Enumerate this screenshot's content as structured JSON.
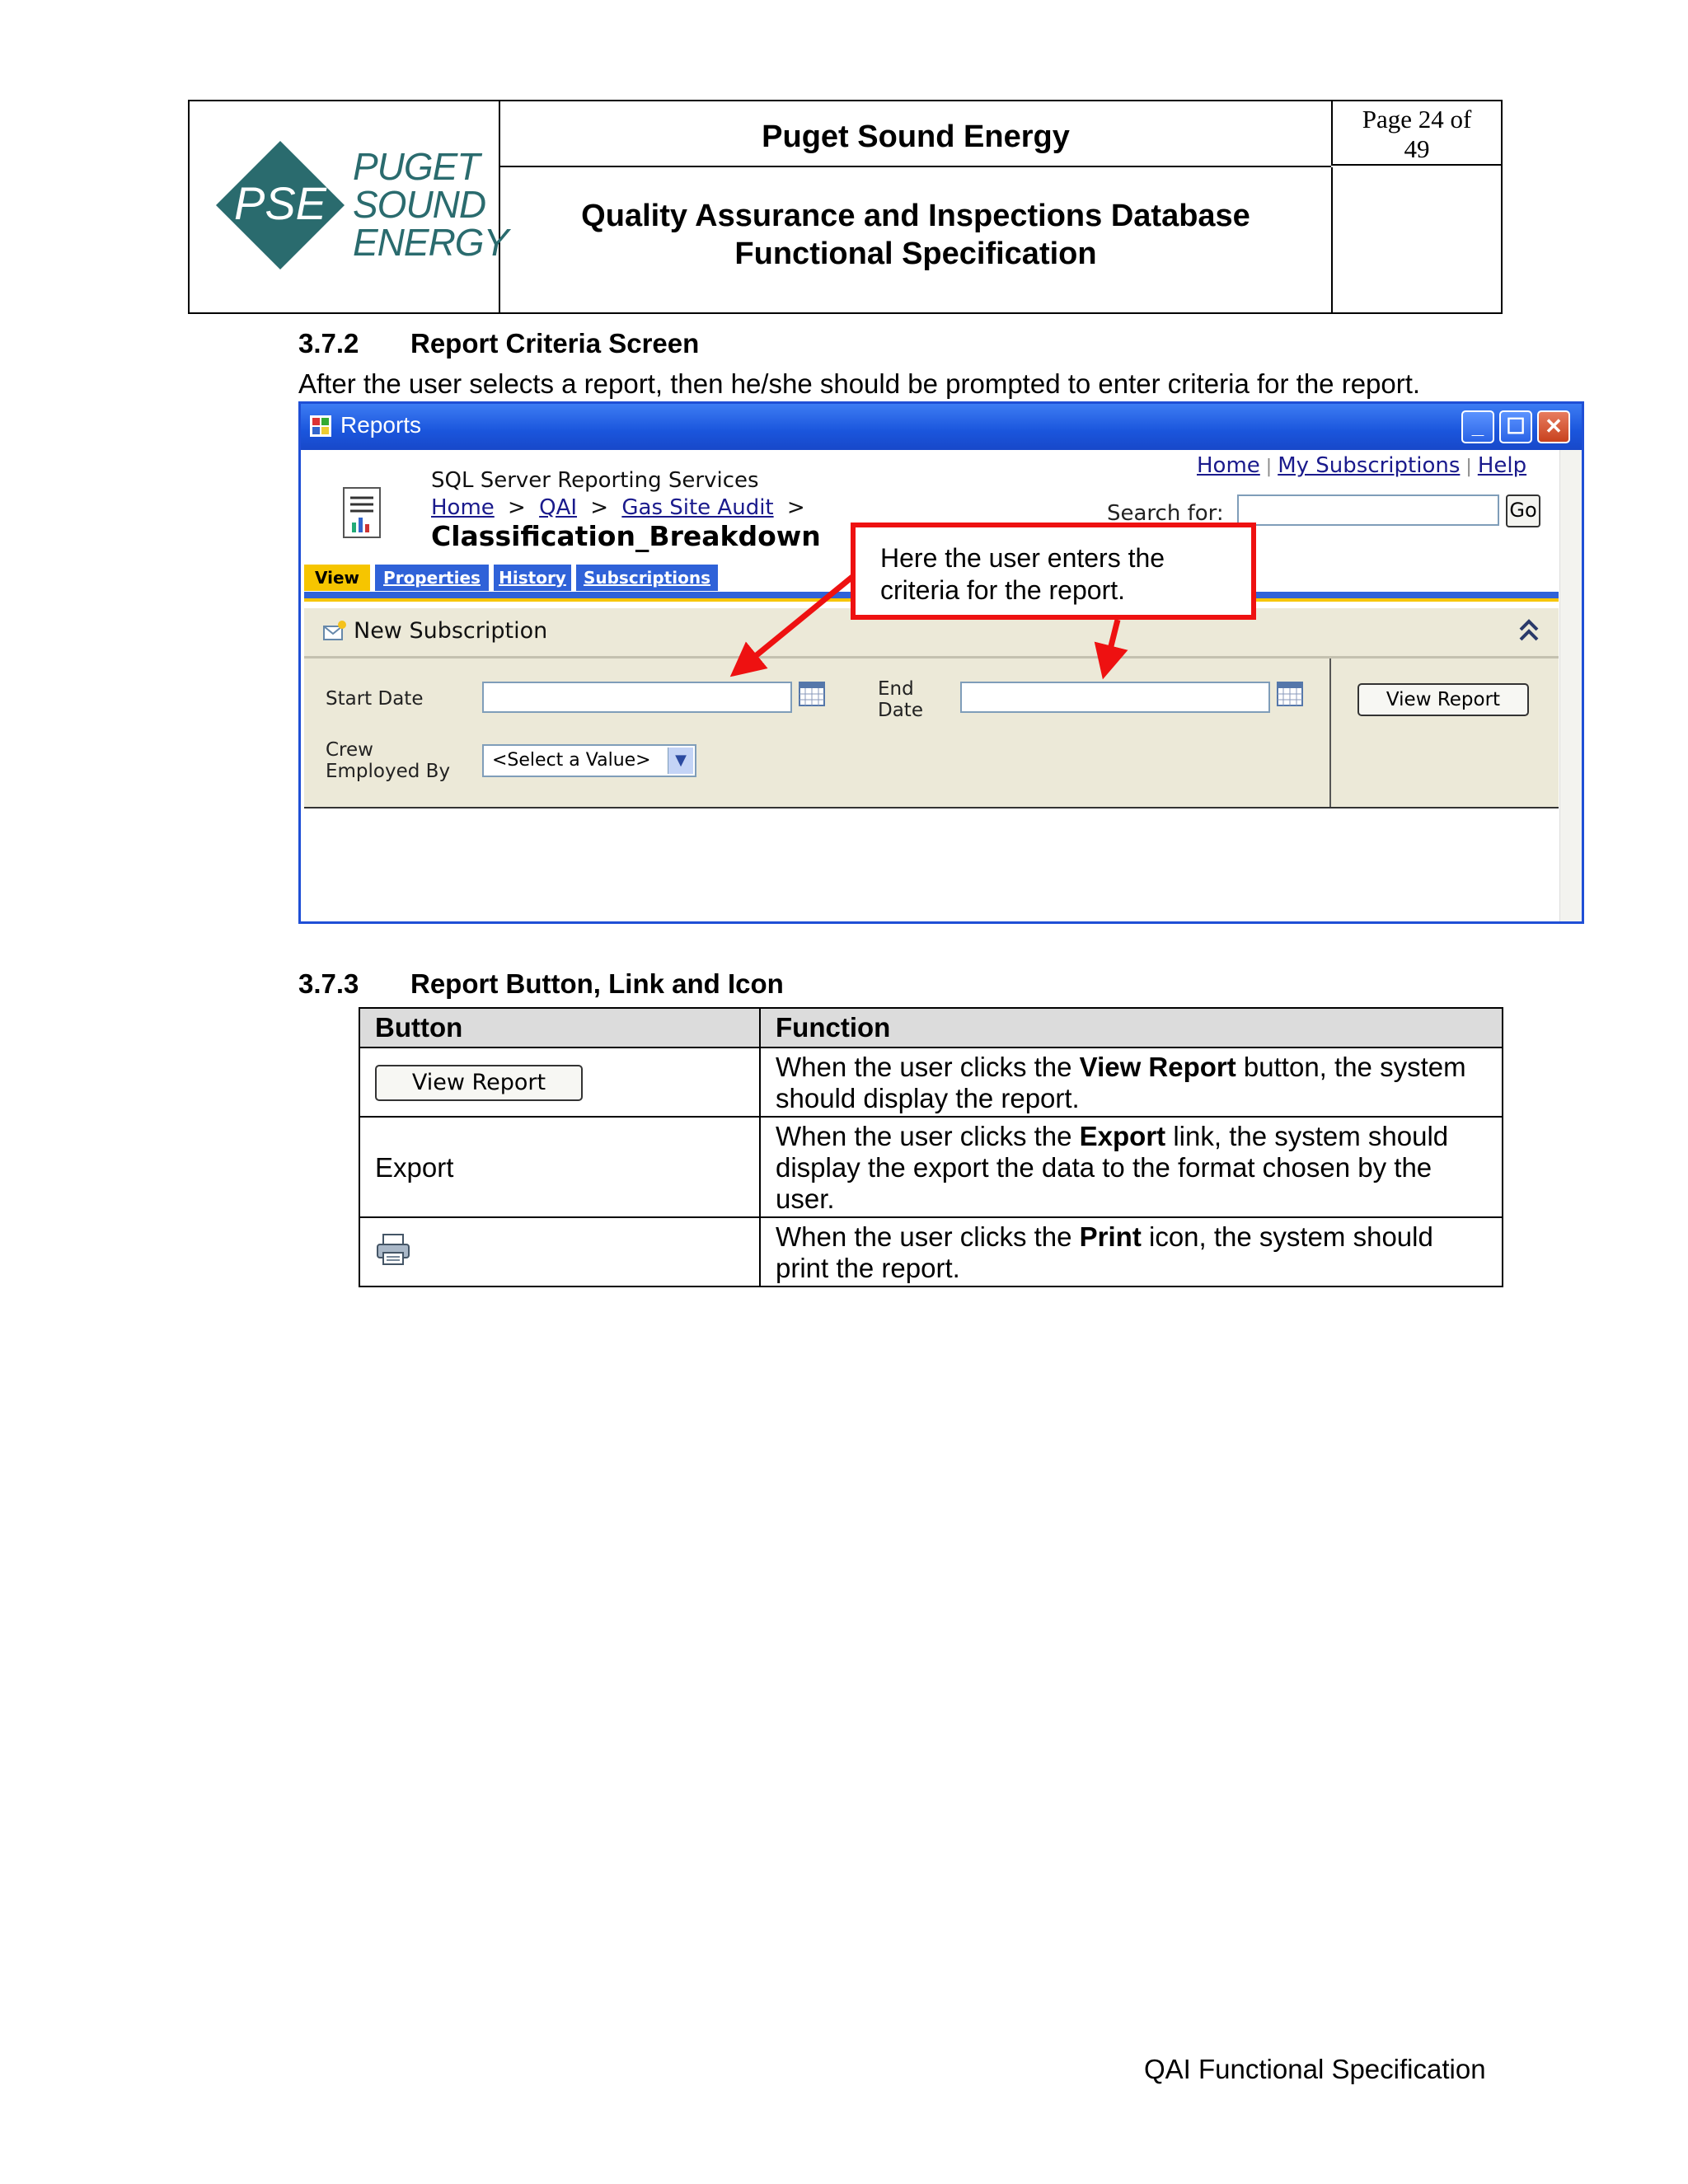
{
  "header": {
    "logo_mark": "PSE",
    "logo_words": [
      "PUGET",
      "SOUND",
      "ENERGY"
    ],
    "organization": "Puget Sound Energy",
    "doc_title_line1": "Quality Assurance and Inspections Database",
    "doc_title_line2": "Functional Specification",
    "page_line1": "Page 24 of",
    "page_line2": "49",
    "logo_color": "#2a6b6e"
  },
  "section_372": {
    "number": "3.7.2",
    "title": "Report Criteria Screen",
    "text": "After the user selects a report, then he/she should be prompted to enter criteria for the report."
  },
  "screenshot": {
    "window_title": "Reports",
    "app_name": "SQL Server Reporting Services",
    "breadcrumbs": [
      "Home",
      "QAI",
      "Gas Site Audit"
    ],
    "breadcrumb_sep": ">",
    "report_name": "Classification_Breakdown",
    "top_links": [
      "Home",
      "My Subscriptions",
      "Help"
    ],
    "search_label": "Search for:",
    "go_label": "Go",
    "tabs": [
      "View",
      "Properties",
      "History",
      "Subscriptions"
    ],
    "subscription_label": "New Subscription",
    "params": {
      "start_date_label": "Start Date",
      "end_date_label_1": "End",
      "end_date_label_2": "Date",
      "crew_label_1": "Crew",
      "crew_label_2": "Employed By",
      "crew_select_value": "<Select a Value>"
    },
    "view_report_label": "View Report",
    "callout_line1": "Here the user enters the",
    "callout_line2": "criteria for the report."
  },
  "section_373": {
    "number": "3.7.3",
    "title": "Report Button, Link and Icon"
  },
  "functions_table": {
    "headers": [
      "Button",
      "Function"
    ],
    "rows": [
      {
        "item": "View Report",
        "pre": "When the user clicks the ",
        "bold": "View Report",
        "post": " button, the system should display the report."
      },
      {
        "item": "Export",
        "pre": "When the user clicks the ",
        "bold": "Export",
        "post": " link, the system should display the export the data to the format chosen by the user."
      },
      {
        "item": "print-icon",
        "pre": "When the user clicks the ",
        "bold": "Print",
        "post": " icon, the system should print the report."
      }
    ]
  },
  "footer": "QAI Functional Specification"
}
